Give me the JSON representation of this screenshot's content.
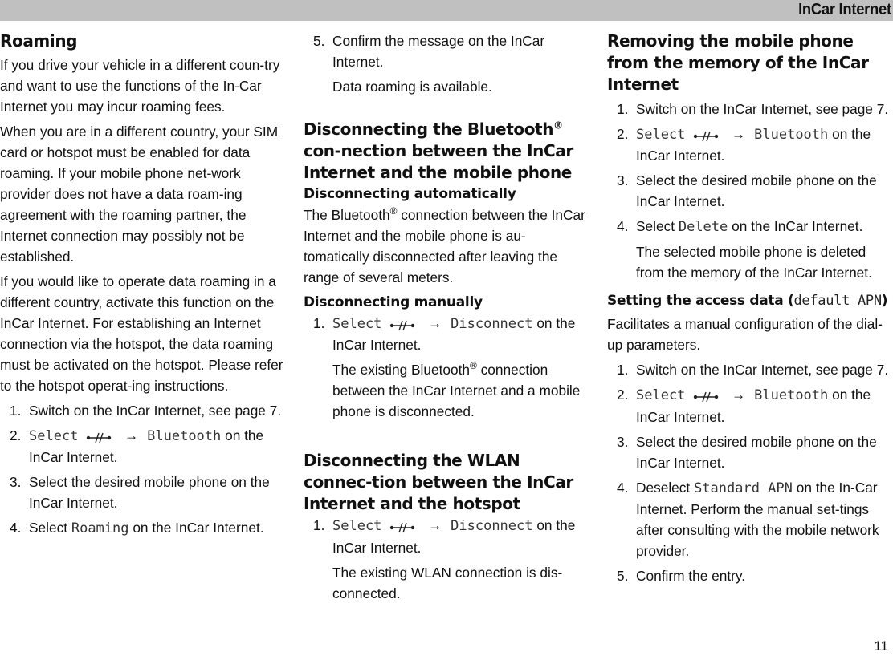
{
  "header": {
    "title": "InCar Internet"
  },
  "page_number": "11",
  "icon_labels": {
    "arrow": "→"
  },
  "col1": {
    "heading": "Roaming",
    "paragraphs": [
      "If you drive your vehicle in a different coun-try and want to use the functions of the In-Car Internet you may incur roaming fees.",
      "When you are in a different country, your SIM card or hotspot must be enabled for data roaming. If your mobile phone net-work provider does not have a data roam-ing agreement with the roaming partner, the Internet connection may possibly not be established.",
      "If you would like to operate data roaming in a different country, activate this function on the InCar Internet. For establishing an Internet connection via the hotspot, the data roaming must be activated on the hotspot. Please refer to the hotspot operat-ing instructions."
    ],
    "steps": [
      {
        "num": "1.",
        "text": "Switch on the InCar Internet, see page 7."
      },
      {
        "num": "2.",
        "mono1": "Select",
        "mono2": "Bluetooth",
        "suffix": "on the InCar Internet."
      },
      {
        "num": "3.",
        "text": "Select the desired mobile phone on the InCar Internet."
      },
      {
        "num": "4.",
        "prefix": "Select",
        "mono": "Roaming",
        "suffix": "on the InCar Internet."
      }
    ]
  },
  "col2": {
    "step5": {
      "num": "5.",
      "text": "Confirm the message on the InCar Internet."
    },
    "step5_note": "Data roaming is available.",
    "section1": {
      "heading_pre": "Disconnecting the Bluetooth",
      "heading_reg": "®",
      "heading_post": " con-nection between the InCar Internet and the mobile phone",
      "sub_auto": "Disconnecting automatically",
      "auto_pre": "The Bluetooth",
      "auto_reg": "®",
      "auto_post": " connection between the InCar Internet and the mobile phone is au-tomatically disconnected after leaving the range of several meters.",
      "sub_manual": "Disconnecting manually",
      "step1": {
        "num": "1.",
        "mono1": "Select",
        "mono2": "Disconnect",
        "suffix": "on the InCar Internet."
      },
      "step1_note_pre": "The existing Bluetooth",
      "step1_note_reg": "®",
      "step1_note_post": " connection between the InCar Internet and a mobile phone is disconnected."
    },
    "section2": {
      "heading": "Disconnecting the WLAN connec-tion between the InCar Internet and the hotspot",
      "step1": {
        "num": "1.",
        "mono1": "Select",
        "mono2": "Disconnect",
        "suffix": "on the InCar Internet."
      },
      "step1_note": "The existing WLAN connection is dis-connected."
    }
  },
  "col3": {
    "section1": {
      "heading": "Removing the mobile phone from the memory of the InCar Internet",
      "steps": [
        {
          "num": "1.",
          "text": "Switch on the InCar Internet, see page 7."
        },
        {
          "num": "2.",
          "mono1": "Select",
          "mono2": "Bluetooth",
          "suffix": "on the InCar Internet."
        },
        {
          "num": "3.",
          "text": "Select the desired mobile phone on the InCar Internet."
        },
        {
          "num": "4.",
          "prefix": "Select",
          "mono": "Delete",
          "suffix": "on the InCar Internet."
        }
      ],
      "note": "The selected mobile phone is deleted from the memory of the InCar Internet."
    },
    "section2": {
      "heading_text": "Setting the access data (",
      "heading_mono": "default APN",
      "heading_close": ")",
      "intro": "Facilitates a manual configuration of the dial-up parameters.",
      "steps": [
        {
          "num": "1.",
          "text": "Switch on the InCar Internet, see page 7."
        },
        {
          "num": "2.",
          "mono1": "Select",
          "mono2": "Bluetooth",
          "suffix": "on the InCar Internet."
        },
        {
          "num": "3.",
          "text": "Select the desired mobile phone on the InCar Internet."
        },
        {
          "num": "4.",
          "prefix": "Deselect",
          "mono": "Standard APN",
          "suffix": "on the In-Car Internet. Perform the manual set-tings after consulting with the mobile network provider."
        },
        {
          "num": "5.",
          "text": "Confirm the entry."
        }
      ]
    }
  }
}
